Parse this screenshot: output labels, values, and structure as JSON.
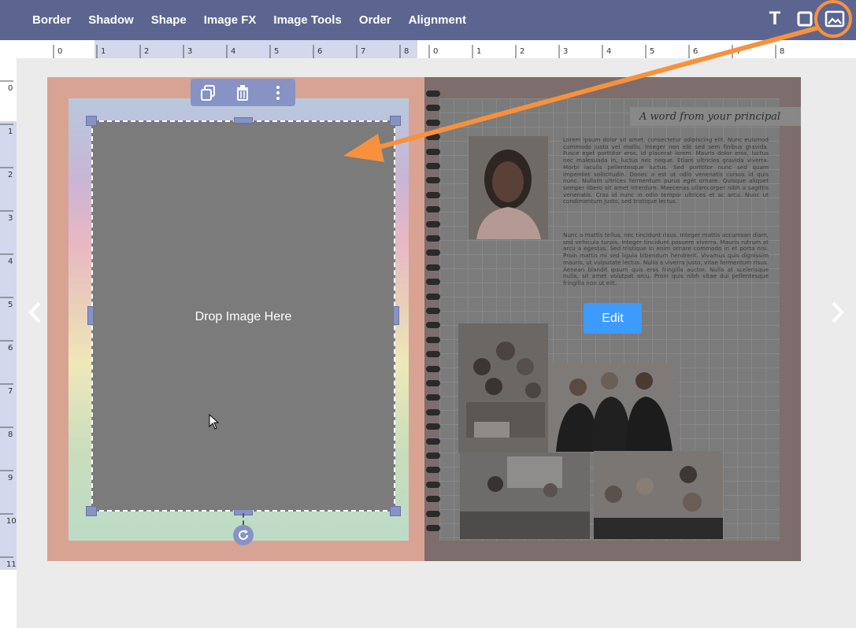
{
  "toolbar": {
    "menu": [
      "Border",
      "Shadow",
      "Shape",
      "Image FX",
      "Image Tools",
      "Order",
      "Alignment"
    ],
    "icons": [
      "text-tool-icon",
      "shape-box-icon",
      "image-tool-icon"
    ],
    "text_tool_label": "T",
    "accent_color": "#5b6590",
    "highlight_color": "#f7913d"
  },
  "ruler": {
    "top_left_page": [
      "0",
      "1",
      "2",
      "3",
      "4",
      "5",
      "6",
      "7",
      "8"
    ],
    "top_right_page": [
      "0",
      "1",
      "2",
      "3",
      "4",
      "5",
      "6",
      "7",
      "8"
    ],
    "left": [
      "0",
      "1",
      "2",
      "3",
      "4",
      "5",
      "6",
      "7",
      "8",
      "9",
      "10",
      "11"
    ]
  },
  "left_page": {
    "drop_text": "Drop Image Here",
    "object_toolbar": [
      "duplicate-icon",
      "trash-icon",
      "more-vert-icon"
    ]
  },
  "right_page": {
    "banner": "A word from your principal",
    "para1": "Lorem ipsum dolor sit amet, consectetur adipiscing elit. Nunc euismod commodo justo vel mollis. Integer non elit sed sem finibus gravida. Fusce eget porttitor eros, id placerat lorem. Mauris dolor eros, luctus nec malesuada in, luctus nec neque. Etiam ultricies gravida viverra. Morbi iaculis pellentesque luctus. Sed porttitor nunc sed quam imperdiet sollicitudin. Donec a est ut odio venenatis cursus id quis nunc. Nullam ultrices fermentum purus eget ornare. Quisque aliquet semper libero sit amet interdum. Maecenas ullamcorper nibh a sagittis venenatis. Cras id nunc in odio tempor ultrices et ac arcu. Nunc ut condimentum justo, sed tristique lectus.",
    "para2": "Nunc a mattis tellus, nec tincidunt risus. Integer mattis accumsan diam, sed vehicula turpis. Integer tincidunt posuere viverra. Mauris rutrum at arcu a egestas. Sed tristique in enim ornare commodo in et porta nisi. Proin mattis mi sed ligula bibendum hendrerit. Vivamus quis dignissim mauris, ut vulputate lectus. Nulla a viverra justo, vitae fermentum risus. Aenean blandit ipsum quis eros fringilla auctor. Nulla at scelerisque nulla, sit amet volutpat arcu. Proin quis nibh vitae dui pellentesque fringilla non ut elit.",
    "edit_label": "Edit"
  },
  "nav": {
    "prev": "‹",
    "next": "›"
  }
}
